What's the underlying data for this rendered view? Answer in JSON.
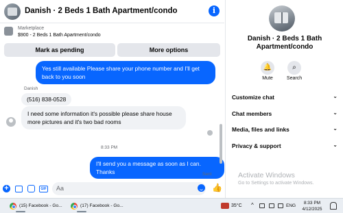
{
  "header": {
    "title": "Danish · 2 Beds 1 Bath Apartment/condo"
  },
  "marketplace": {
    "label": "Marketplace",
    "listing": "$900 - 2 Beds 1 Bath Apartment/condo",
    "mark_pending": "Mark as pending",
    "more_options": "More options"
  },
  "messages": {
    "msg1": "Yes still available Please share your phone number and I'll get back to you soon",
    "sender": "Danish",
    "msg2": "(516) 838-0528",
    "msg3": "I need some information it's possible please share house more pictures and it's two bad rooms",
    "timestamp": "8:33 PM",
    "msg4": "I'll send you a message as soon as I can. Thanks",
    "sent_status": "Sent"
  },
  "composer": {
    "placeholder": "Aa"
  },
  "info_panel": {
    "name": "Danish · 2 Beds 1 Bath Apartment/condo",
    "mute_label": "Mute",
    "search_label": "Search",
    "sections": [
      "Customize chat",
      "Chat members",
      "Media, files and links",
      "Privacy & support"
    ],
    "watermark_title": "Activate Windows",
    "watermark_sub": "Go to Settings to activate Windows."
  },
  "taskbar": {
    "tasks": [
      "(15) Facebook - Go...",
      "(17) Facebook - Go..."
    ],
    "temperature": "35°C",
    "language": "ENG",
    "time": "8:33 PM",
    "date": "4/12/2025"
  },
  "colors": {
    "accent": "#0866ff",
    "incoming_bubble": "#f0f2f5"
  }
}
